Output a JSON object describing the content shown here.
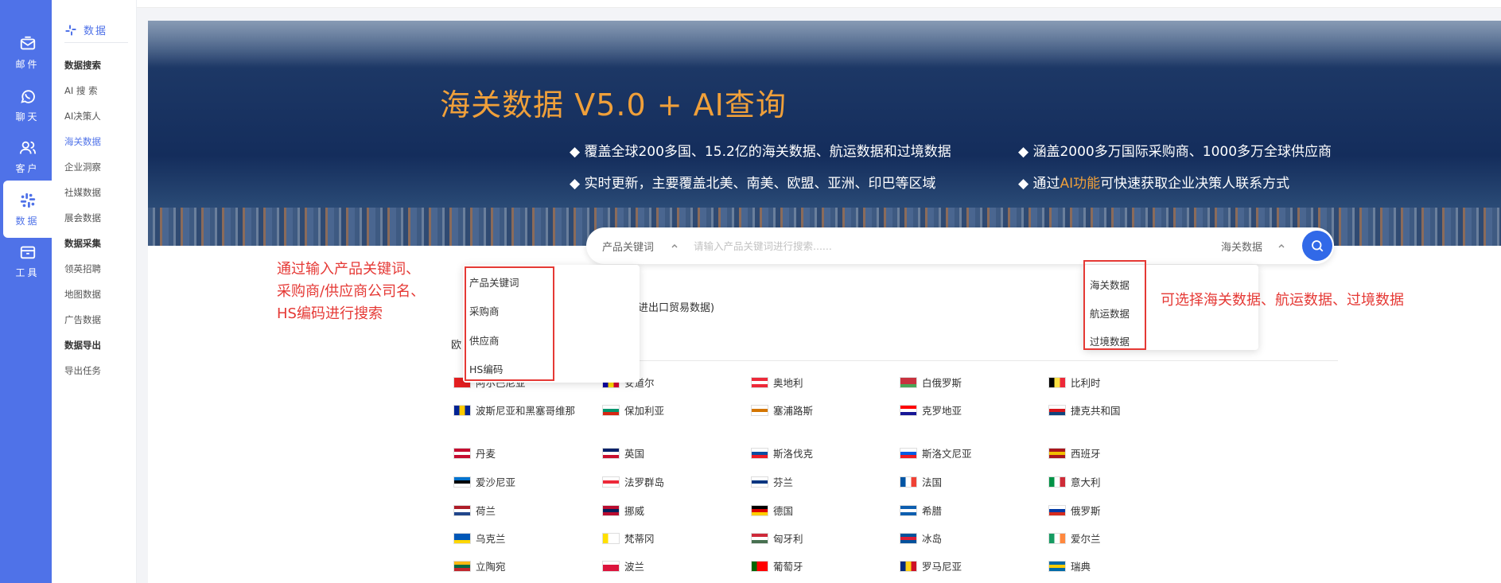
{
  "rail": [
    {
      "icon": "mail-icon",
      "label": "邮件"
    },
    {
      "icon": "whatsapp-icon",
      "label": "聊天"
    },
    {
      "icon": "users-icon",
      "label": "客户"
    },
    {
      "icon": "data-icon",
      "label": "数据",
      "active": true
    },
    {
      "icon": "toolbox-icon",
      "label": "工具"
    }
  ],
  "subnav": {
    "header": "数据",
    "groups": [
      {
        "title": "数据搜索",
        "items": [
          "AI 搜 索",
          "AI决策人",
          "海关数据",
          "企业洞察",
          "社媒数据",
          "展会数据"
        ]
      },
      {
        "title": "数据采集",
        "items": [
          "领英招聘",
          "地图数据",
          "广告数据"
        ]
      },
      {
        "title": "数据导出",
        "items": [
          "导出任务"
        ]
      }
    ],
    "active": "海关数据"
  },
  "hero": {
    "title": "海关数据 V5.0 + AI查询",
    "bullets": [
      "覆盖全球200多国、15.2亿的海关数据、航运数据和过境数据",
      "涵盖2000多万国际采购商、1000多万全球供应商",
      "实时更新，主要覆盖北美、南美、欧盟、亚洲、印巴等区域",
      {
        "pre": "通过",
        "highlight": "AI功能",
        "post": "可快速获取企业决策人联系方式"
      }
    ]
  },
  "search": {
    "category": "产品关键词",
    "placeholder": "请输入产品关键词进行搜索......",
    "value": "",
    "data_type": "海关数据"
  },
  "category_menu": [
    "产品关键词",
    "采购商",
    "供应商",
    "HS编码"
  ],
  "datatype_menu": [
    "海关数据",
    "航运数据",
    "过境数据"
  ],
  "annotations": {
    "left": [
      "通过输入产品关键词、",
      "采购商/供应商公司名、",
      "HS编码进行搜索"
    ],
    "right": "可选择海关数据、航运数据、过境数据"
  },
  "partial_texts": {
    "trade_hint": "进出口贸易数据)",
    "region": "欧"
  },
  "countries": [
    {
      "name": "阿尔巴尼亚",
      "flag": [
        "#e41e20",
        "#e41e20",
        "#e41e20"
      ]
    },
    {
      "name": "安道尔",
      "flag": [
        "#10069f",
        "#fedd00",
        "#d50032"
      ],
      "vertical": true
    },
    {
      "name": "奥地利",
      "flag": [
        "#ed2939",
        "#ffffff",
        "#ed2939"
      ]
    },
    {
      "name": "白俄罗斯",
      "flag": [
        "#c8313e",
        "#c8313e",
        "#4aa657"
      ]
    },
    {
      "name": "比利时",
      "flag": [
        "#000000",
        "#fae042",
        "#ed2939"
      ],
      "vertical": true
    },
    {
      "name": "波斯尼亚和黑塞哥维那",
      "flag": [
        "#002395",
        "#fecb00",
        "#002395"
      ],
      "vertical": true
    },
    {
      "name": "保加利亚",
      "flag": [
        "#ffffff",
        "#00966e",
        "#d62612"
      ]
    },
    {
      "name": "塞浦路斯",
      "flag": [
        "#ffffff",
        "#d47600",
        "#ffffff"
      ]
    },
    {
      "name": "克罗地亚",
      "flag": [
        "#ff0000",
        "#ffffff",
        "#171796"
      ]
    },
    {
      "name": "捷克共和国",
      "flag": [
        "#ffffff",
        "#d7141a",
        "#11457e"
      ]
    },
    {
      "name": "丹麦",
      "flag": [
        "#c60c30",
        "#ffffff",
        "#c60c30"
      ]
    },
    {
      "name": "英国",
      "flag": [
        "#012169",
        "#ffffff",
        "#c8102e"
      ]
    },
    {
      "name": "斯洛伐克",
      "flag": [
        "#ffffff",
        "#0b4ea2",
        "#ee1c25"
      ]
    },
    {
      "name": "斯洛文尼亚",
      "flag": [
        "#ffffff",
        "#005ce5",
        "#ed1c24"
      ]
    },
    {
      "name": "西班牙",
      "flag": [
        "#aa151b",
        "#f1bf00",
        "#aa151b"
      ]
    },
    {
      "name": "爱沙尼亚",
      "flag": [
        "#0072ce",
        "#000000",
        "#ffffff"
      ]
    },
    {
      "name": "法罗群岛",
      "flag": [
        "#ffffff",
        "#ed2939",
        "#ffffff"
      ]
    },
    {
      "name": "芬兰",
      "flag": [
        "#ffffff",
        "#003580",
        "#ffffff"
      ]
    },
    {
      "name": "法国",
      "flag": [
        "#0055a4",
        "#ffffff",
        "#ef4135"
      ],
      "vertical": true
    },
    {
      "name": "意大利",
      "flag": [
        "#009246",
        "#ffffff",
        "#ce2b37"
      ],
      "vertical": true
    },
    {
      "name": "荷兰",
      "flag": [
        "#ae1c28",
        "#ffffff",
        "#21468b"
      ]
    },
    {
      "name": "挪威",
      "flag": [
        "#ba0c2f",
        "#00205b",
        "#ba0c2f"
      ]
    },
    {
      "name": "德国",
      "flag": [
        "#000000",
        "#dd0000",
        "#ffce00"
      ]
    },
    {
      "name": "希腊",
      "flag": [
        "#0d5eaf",
        "#ffffff",
        "#0d5eaf"
      ]
    },
    {
      "name": "俄罗斯",
      "flag": [
        "#ffffff",
        "#0039a6",
        "#d52b1e"
      ]
    },
    {
      "name": "乌克兰",
      "flag": [
        "#0057b7",
        "#0057b7",
        "#ffd700"
      ]
    },
    {
      "name": "梵蒂冈",
      "flag": [
        "#ffe000",
        "#ffffff",
        "#ffffff"
      ],
      "vertical": true
    },
    {
      "name": "匈牙利",
      "flag": [
        "#ce2939",
        "#ffffff",
        "#477050"
      ]
    },
    {
      "name": "冰岛",
      "flag": [
        "#02529c",
        "#dc1e35",
        "#02529c"
      ]
    },
    {
      "name": "爱尔兰",
      "flag": [
        "#169b62",
        "#ffffff",
        "#ff883e"
      ],
      "vertical": true
    },
    {
      "name": "立陶宛",
      "flag": [
        "#fdb913",
        "#006a44",
        "#c1272d"
      ]
    },
    {
      "name": "波兰",
      "flag": [
        "#ffffff",
        "#dc143c",
        "#dc143c"
      ]
    },
    {
      "name": "葡萄牙",
      "flag": [
        "#006600",
        "#ff0000",
        "#ff0000"
      ],
      "vertical": true
    },
    {
      "name": "罗马尼亚",
      "flag": [
        "#002b7f",
        "#fcd116",
        "#ce1126"
      ],
      "vertical": true
    },
    {
      "name": "瑞典",
      "flag": [
        "#006aa7",
        "#fecc00",
        "#006aa7"
      ]
    }
  ],
  "colors": {
    "accent": "#4f72e8",
    "brand_orange": "#f0a03a",
    "annotation_red": "#e53935",
    "search_button": "#3169e8"
  }
}
